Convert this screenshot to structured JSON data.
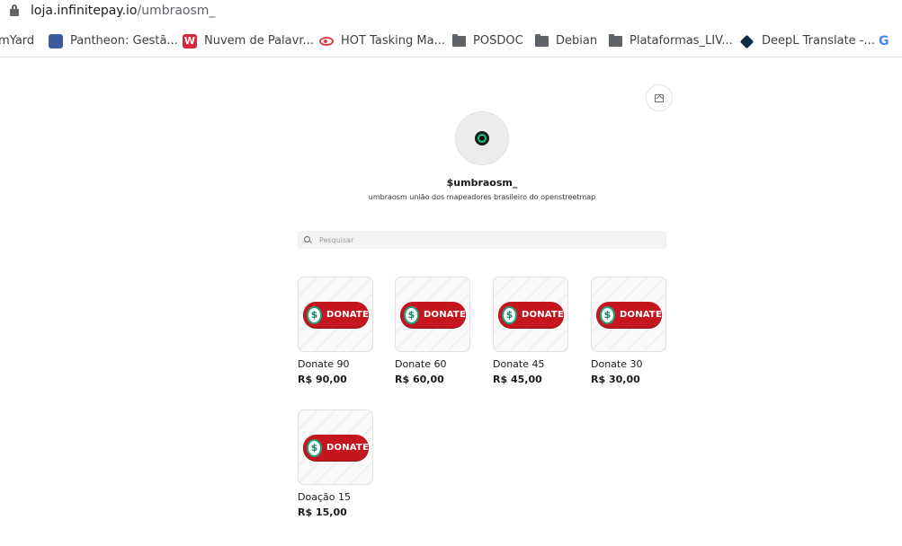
{
  "browser": {
    "url_host": "loja.infinitepay.io",
    "url_path": "/umbraosm_"
  },
  "bookmarks": [
    {
      "label": "mYard",
      "icon": "none"
    },
    {
      "label": "Pantheon: Gestã...",
      "icon": "pantheon-icon"
    },
    {
      "label": "Nuvem de Palavr...",
      "icon": "nuvem-icon"
    },
    {
      "label": "HOT Tasking Ma...",
      "icon": "hot-icon"
    },
    {
      "label": "POSDOC",
      "icon": "folder-icon"
    },
    {
      "label": "Debian",
      "icon": "folder-icon"
    },
    {
      "label": "Plataformas_LIV...",
      "icon": "folder-icon"
    },
    {
      "label": "DeepL Translate -...",
      "icon": "deepl-icon"
    },
    {
      "label": "G",
      "icon": "google-icon"
    }
  ],
  "store": {
    "name": "$umbraosm_",
    "description": "umbraosm união dos mapeadores brasileiro do openstreetmap",
    "avatar_icon": "green-ring-logo"
  },
  "search": {
    "placeholder": "Pesquisar",
    "value": ""
  },
  "products": [
    {
      "name": "Donate 90",
      "price": "R$ 90,00",
      "badge": "DONATE",
      "coin": "$"
    },
    {
      "name": "Donate 60",
      "price": "R$ 60,00",
      "badge": "DONATE",
      "coin": "$"
    },
    {
      "name": "Donate 45",
      "price": "R$ 45,00",
      "badge": "DONATE",
      "coin": "$"
    },
    {
      "name": "Donate 30",
      "price": "R$ 30,00",
      "badge": "DONATE",
      "coin": "$"
    },
    {
      "name": "Doação 15",
      "price": "R$ 15,00",
      "badge": "DONATE",
      "coin": "$"
    }
  ],
  "colors": {
    "donate_red": "#c5161f",
    "coin_green": "#1fa37a",
    "avatar_ring": "#19c37d"
  }
}
